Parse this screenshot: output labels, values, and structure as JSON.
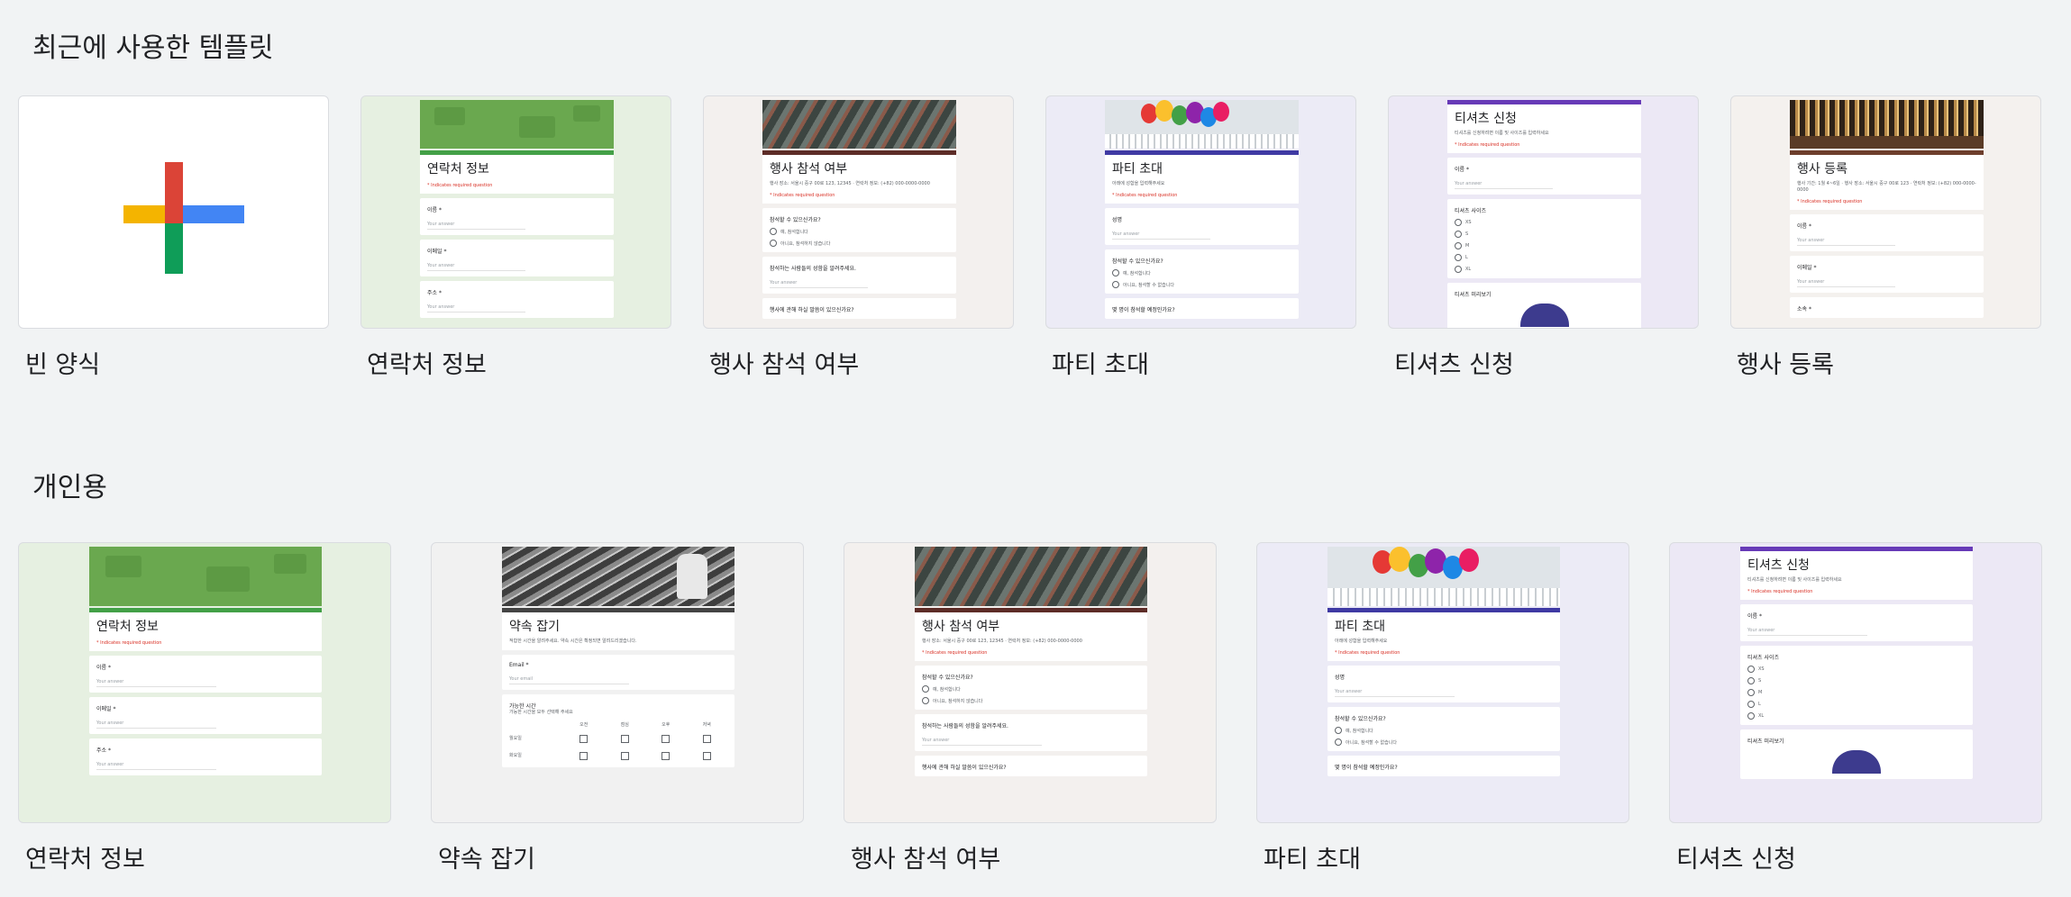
{
  "recent": {
    "title": "최근에 사용한 템플릿",
    "cards": [
      {
        "label": "빈 양식"
      },
      {
        "label": "연락처 정보"
      },
      {
        "label": "행사 참석 여부"
      },
      {
        "label": "파티 초대"
      },
      {
        "label": "티셔츠 신청"
      },
      {
        "label": "행사 등록"
      }
    ]
  },
  "personal": {
    "title": "개인용",
    "cards": [
      {
        "label": "연락처 정보"
      },
      {
        "label": "약속 잡기"
      },
      {
        "label": "행사 참석 여부"
      },
      {
        "label": "파티 초대"
      },
      {
        "label": "티셔츠 신청"
      }
    ]
  },
  "previews": {
    "required_text": "* Indicates required question",
    "answer_placeholder": "Your answer",
    "email_placeholder": "Your email",
    "contact": {
      "title": "연락처 정보",
      "q1": "이름 *",
      "q2": "이메일 *",
      "q3": "주소 *"
    },
    "rsvp": {
      "title": "행사 참석 여부",
      "desc": "행사 장소: 서울시 중구 00로 123, 12345 · 연락처 정보: (+82) 000-0000-0000",
      "q1": "참석할 수 있으신가요?",
      "opt1": "예, 참석합니다",
      "opt2": "아니요, 참석하지 않습니다",
      "q2": "참석하는 사람들의 성함을 알려주세요.",
      "q3": "행사에 관해 하실 말씀이 있으신가요?"
    },
    "party": {
      "title": "파티 초대",
      "desc": "아래에 성함을 입력해주세요",
      "q1": "성명",
      "q2": "참석할 수 있으신가요?",
      "opt1": "예, 참석합니다",
      "opt2": "아니요, 참석할 수 없습니다",
      "q3": "몇 명이 참석할 예정인가요?"
    },
    "tshirt": {
      "title": "티셔츠 신청",
      "desc": "티셔츠를 신청하려면 이름 및 사이즈를 입력하세요",
      "q1": "이름 *",
      "q2": "티셔츠 사이즈",
      "sizes": [
        "XS",
        "S",
        "M",
        "L",
        "XL"
      ],
      "q3": "티셔츠 미리보기"
    },
    "event": {
      "title": "행사 등록",
      "desc": "행사 기간: 1월 4~6일 · 행사 장소: 서울시 중구 00로 123 · 연락처 정보: (+82) 000-0000-0000",
      "q1": "이름 *",
      "q2": "이메일 *",
      "q3": "소속 *"
    },
    "meeting": {
      "title": "약속 잡기",
      "desc": "적합한 시간을 알려주세요. 약속 시간은 확정되면 알려드리겠습니다.",
      "q1": "Email *",
      "q2": "가능한 시간",
      "q2_sub": "가능한 시간을 모두 선택해 주세요",
      "days": [
        "오전",
        "점심",
        "오후",
        "저녁"
      ],
      "rows": [
        "월요일",
        "화요일"
      ]
    }
  },
  "colors": {
    "page_bg": "#f1f3f4",
    "contact_accent": "#43a047",
    "rsvp_accent": "#5d2c27",
    "party_accent": "#3f3aa3",
    "tshirt_accent": "#673ab7",
    "event_accent": "#6d3e2c",
    "meeting_accent": "#444444",
    "plus_red": "#db4437",
    "plus_blue": "#4285f4",
    "plus_green": "#0f9d58",
    "plus_yellow": "#f4b400"
  }
}
